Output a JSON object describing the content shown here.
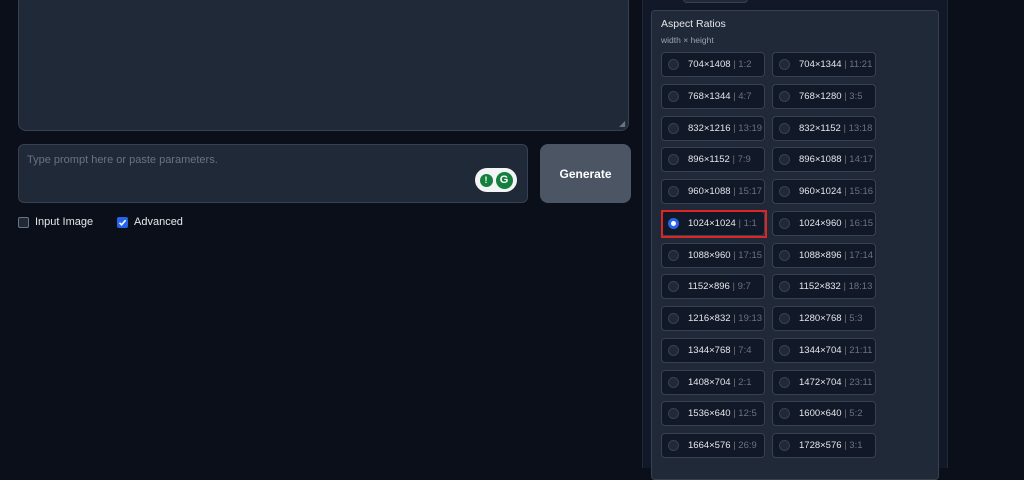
{
  "prompt": {
    "placeholder": "Type prompt here or paste parameters."
  },
  "generate_label": "Generate",
  "options_row": {
    "input_image": {
      "label": "Input Image",
      "checked": false
    },
    "advanced": {
      "label": "Advanced",
      "checked": true
    }
  },
  "aspect": {
    "title": "Aspect Ratios",
    "subtitle": "width × height",
    "selected_index": 10,
    "options": [
      {
        "res": "704×1408",
        "ratio": "| 1:2"
      },
      {
        "res": "704×1344",
        "ratio": "| 11:21"
      },
      {
        "res": "768×1344",
        "ratio": "| 4:7"
      },
      {
        "res": "768×1280",
        "ratio": "| 3:5"
      },
      {
        "res": "832×1216",
        "ratio": "| 13:19"
      },
      {
        "res": "832×1152",
        "ratio": "| 13:18"
      },
      {
        "res": "896×1152",
        "ratio": "| 7:9"
      },
      {
        "res": "896×1088",
        "ratio": "| 14:17"
      },
      {
        "res": "960×1088",
        "ratio": "| 15:17"
      },
      {
        "res": "960×1024",
        "ratio": "| 15:16"
      },
      {
        "res": "1024×1024",
        "ratio": "| 1:1"
      },
      {
        "res": "1024×960",
        "ratio": "| 16:15"
      },
      {
        "res": "1088×960",
        "ratio": "| 17:15"
      },
      {
        "res": "1088×896",
        "ratio": "| 17:14"
      },
      {
        "res": "1152×896",
        "ratio": "| 9:7"
      },
      {
        "res": "1152×832",
        "ratio": "| 18:13"
      },
      {
        "res": "1216×832",
        "ratio": "| 19:13"
      },
      {
        "res": "1280×768",
        "ratio": "| 5:3"
      },
      {
        "res": "1344×768",
        "ratio": "| 7:4"
      },
      {
        "res": "1344×704",
        "ratio": "| 21:11"
      },
      {
        "res": "1408×704",
        "ratio": "| 2:1"
      },
      {
        "res": "1472×704",
        "ratio": "| 23:11"
      },
      {
        "res": "1536×640",
        "ratio": "| 12:5"
      },
      {
        "res": "1600×640",
        "ratio": "| 5:2"
      },
      {
        "res": "1664×576",
        "ratio": "| 26:9"
      },
      {
        "res": "1728×576",
        "ratio": "| 3:1"
      }
    ]
  },
  "colors": {
    "accent": "#2563eb",
    "highlight": "#dc2626",
    "background": "#0b0f19"
  }
}
